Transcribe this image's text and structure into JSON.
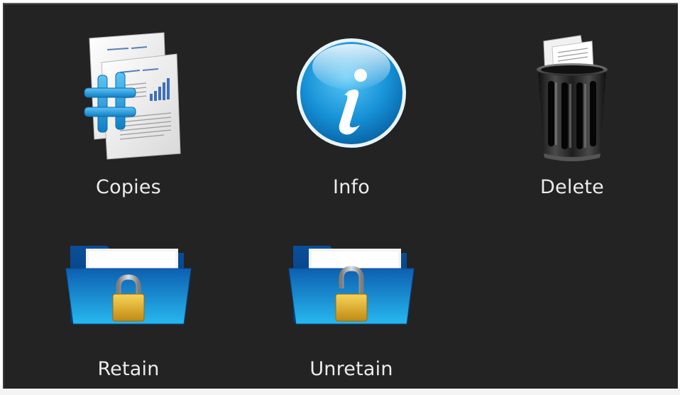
{
  "actions": {
    "copies": {
      "label": "Copies",
      "icon": "copies-document-icon"
    },
    "info": {
      "label": "Info",
      "icon": "info-icon"
    },
    "delete": {
      "label": "Delete",
      "icon": "trash-bin-icon"
    },
    "retain": {
      "label": "Retain",
      "icon": "locked-folder-icon"
    },
    "unretain": {
      "label": "Unretain",
      "icon": "unlocked-folder-icon"
    }
  },
  "colors": {
    "background": "#232323",
    "label_text": "#ececec",
    "accent_blue": "#1a8fd6",
    "lock_gold": "#d9a520"
  }
}
